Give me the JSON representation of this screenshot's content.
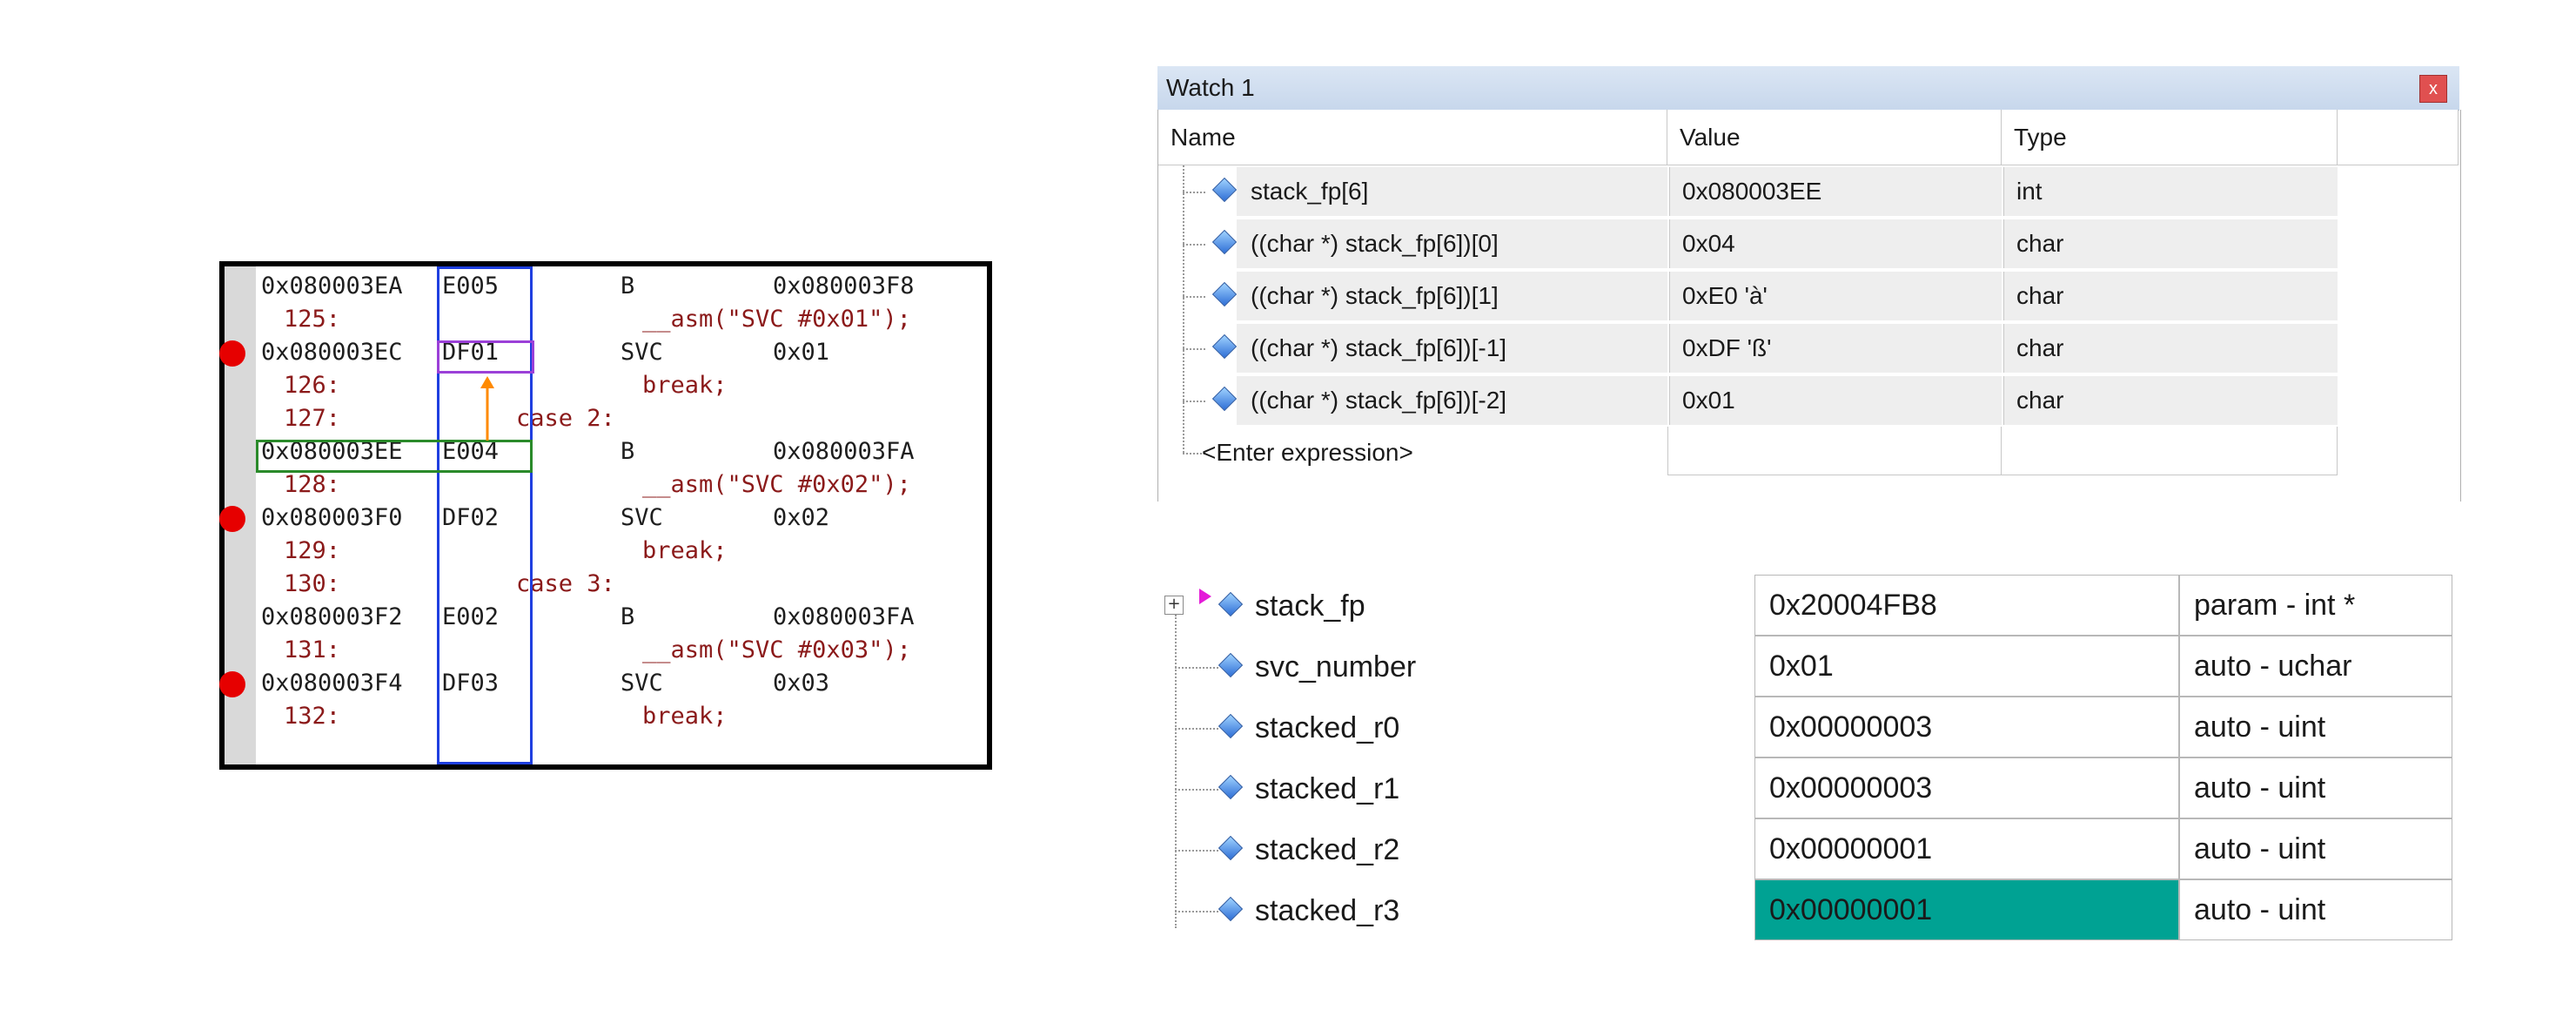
{
  "disassembly": {
    "rows": [
      {
        "kind": "asm",
        "addr": "0x080003EA",
        "code": "E005",
        "mnem": "B",
        "arg": "0x080003F8",
        "bp": false
      },
      {
        "kind": "src",
        "lnum": "125:",
        "src": "__asm(\"SVC #0x01\");",
        "indent": "deep"
      },
      {
        "kind": "asm",
        "addr": "0x080003EC",
        "code": "DF01",
        "mnem": "SVC",
        "arg": "0x01",
        "bp": true
      },
      {
        "kind": "src",
        "lnum": "126:",
        "src": "break;",
        "indent": "deep"
      },
      {
        "kind": "src",
        "lnum": "127:",
        "src": "case 2:",
        "indent": "shallow"
      },
      {
        "kind": "asm",
        "addr": "0x080003EE",
        "code": "E004",
        "mnem": "B",
        "arg": "0x080003FA",
        "bp": false
      },
      {
        "kind": "src",
        "lnum": "128:",
        "src": "__asm(\"SVC #0x02\");",
        "indent": "deep"
      },
      {
        "kind": "asm",
        "addr": "0x080003F0",
        "code": "DF02",
        "mnem": "SVC",
        "arg": "0x02",
        "bp": true
      },
      {
        "kind": "src",
        "lnum": "129:",
        "src": "break;",
        "indent": "deep"
      },
      {
        "kind": "src",
        "lnum": "130:",
        "src": "case 3:",
        "indent": "shallow"
      },
      {
        "kind": "asm",
        "addr": "0x080003F2",
        "code": "E002",
        "mnem": "B",
        "arg": "0x080003FA",
        "bp": false
      },
      {
        "kind": "src",
        "lnum": "131:",
        "src": "__asm(\"SVC #0x03\");",
        "indent": "deep"
      },
      {
        "kind": "asm",
        "addr": "0x080003F4",
        "code": "DF03",
        "mnem": "SVC",
        "arg": "0x03",
        "bp": true
      },
      {
        "kind": "src",
        "lnum": "132:",
        "src": "break;",
        "indent": "deep"
      }
    ],
    "colors": {
      "blue_box": "#1f3fe0",
      "purple_box": "#9b40d8",
      "green_box": "#2a8a2a",
      "arrow": "#ff8a00",
      "breakpoint": "#e60000",
      "source_text": "#8b1a1a"
    }
  },
  "watch": {
    "title": "Watch 1",
    "pin_icon": "՘",
    "close_label": "x",
    "headers": {
      "name": "Name",
      "value": "Value",
      "type": "Type"
    },
    "rows": [
      {
        "name": "stack_fp[6]",
        "value": "0x080003EE",
        "type": "int"
      },
      {
        "name": "((char *) stack_fp[6])[0]",
        "value": "0x04",
        "type": "char"
      },
      {
        "name": "((char *) stack_fp[6])[1]",
        "value": "0xE0 'à'",
        "type": "char"
      },
      {
        "name": "((char *) stack_fp[6])[-1]",
        "value": "0xDF 'ß'",
        "type": "char"
      },
      {
        "name": "((char *) stack_fp[6])[-2]",
        "value": "0x01",
        "type": "char"
      }
    ],
    "enter_expression": "<Enter expression>"
  },
  "locals": {
    "rows": [
      {
        "name": "stack_fp",
        "value": "0x20004FB8",
        "type": "param - int *",
        "expandable": true
      },
      {
        "name": "svc_number",
        "value": "0x01",
        "type": "auto - uchar"
      },
      {
        "name": "stacked_r0",
        "value": "0x00000003",
        "type": "auto - uint"
      },
      {
        "name": "stacked_r1",
        "value": "0x00000003",
        "type": "auto - uint"
      },
      {
        "name": "stacked_r2",
        "value": "0x00000001",
        "type": "auto - uint"
      },
      {
        "name": "stacked_r3",
        "value": "0x00000001",
        "type": "auto - uint",
        "highlight": true
      }
    ],
    "highlight_color": "#00a293",
    "expander_label": "+"
  }
}
